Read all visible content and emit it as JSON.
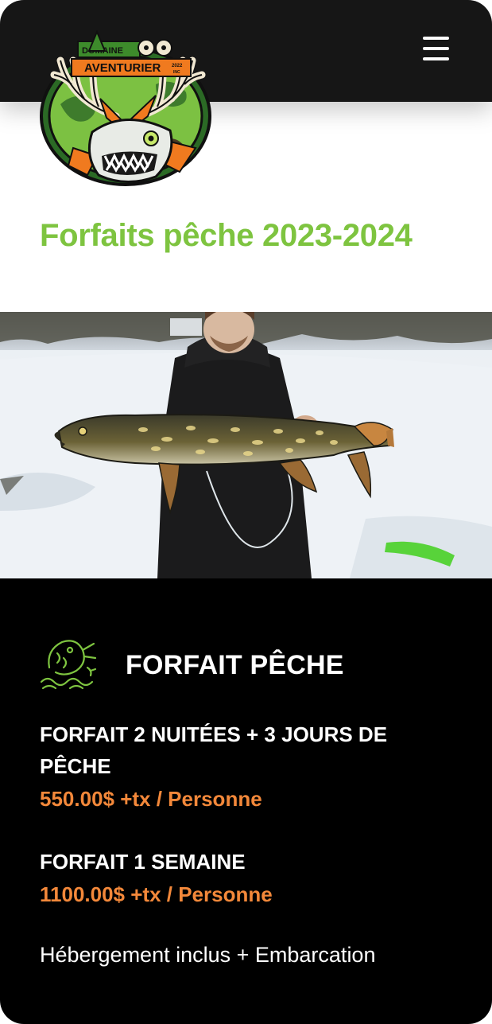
{
  "header": {
    "logo": {
      "words": [
        "DOMAINE",
        "AVENTURIER"
      ],
      "year": "2022",
      "inc": "INC"
    },
    "menu_icon": "hamburger-menu-icon"
  },
  "page": {
    "title": "Forfaits pêche 2023-2024"
  },
  "hero": {
    "image": "ice-fisherman-holding-pike-photo"
  },
  "packages": {
    "icon": "fish-icon",
    "heading": "FORFAIT PÊCHE",
    "items": [
      {
        "name": "FORFAIT 2 NUITÉES + 3 JOURS DE PÊCHE",
        "price": "550.00$ +tx / Personne"
      },
      {
        "name": "FORFAIT 1 SEMAINE",
        "price": "1100.00$ +tx / Personne"
      }
    ],
    "note": "Hébergement inclus + Embarcation"
  },
  "colors": {
    "accent_green": "#7ec440",
    "price_orange": "#f3883a",
    "header_bg": "#161616",
    "section_bg": "#000000"
  }
}
